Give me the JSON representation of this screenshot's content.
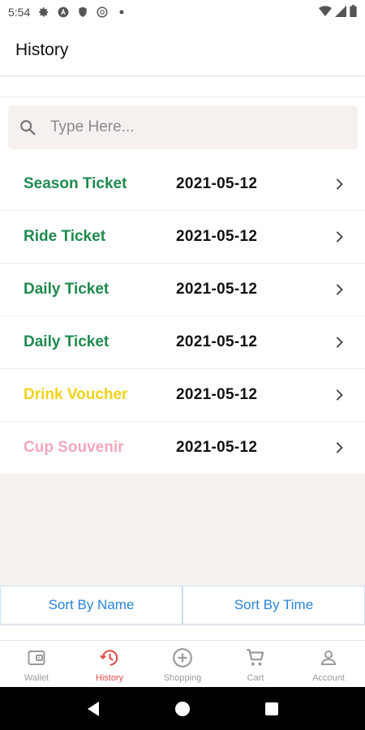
{
  "status_bar": {
    "time": "5:54",
    "icons": [
      "gear-icon",
      "a-logo-icon",
      "shield-icon",
      "circle-a-icon",
      "dot-icon"
    ],
    "right_icons": [
      "wifi-icon",
      "signal-icon",
      "battery-icon"
    ]
  },
  "app_bar": {
    "title": "History"
  },
  "search": {
    "placeholder": "Type Here...",
    "value": "",
    "icon": "search-icon"
  },
  "history": {
    "items": [
      {
        "name": "Season Ticket",
        "date": "2021-05-12",
        "color": "#1e8a4e"
      },
      {
        "name": "Ride Ticket",
        "date": "2021-05-12",
        "color": "#1e8a4e"
      },
      {
        "name": "Daily Ticket",
        "date": "2021-05-12",
        "color": "#1e8a4e"
      },
      {
        "name": "Daily Ticket",
        "date": "2021-05-12",
        "color": "#1e8a4e"
      },
      {
        "name": "Drink Voucher",
        "date": "2021-05-12",
        "color": "#f2d21b"
      },
      {
        "name": "Cup Souvenir",
        "date": "2021-05-12",
        "color": "#f4a7b9"
      }
    ]
  },
  "sort": {
    "by_name": "Sort By Name",
    "by_time": "Sort By Time",
    "color": "#2a84d8"
  },
  "bottom_nav": {
    "active_color": "#e24c4c",
    "items": [
      {
        "label": "Wallet",
        "icon": "wallet-icon",
        "active": false
      },
      {
        "label": "History",
        "icon": "history-icon",
        "active": true
      },
      {
        "label": "Shopping",
        "icon": "plus-circle-icon",
        "active": false
      },
      {
        "label": "Cart",
        "icon": "cart-icon",
        "active": false
      },
      {
        "label": "Account",
        "icon": "person-icon",
        "active": false
      }
    ]
  },
  "system_nav": {
    "icons": [
      "back-icon",
      "home-icon",
      "recents-icon"
    ]
  }
}
